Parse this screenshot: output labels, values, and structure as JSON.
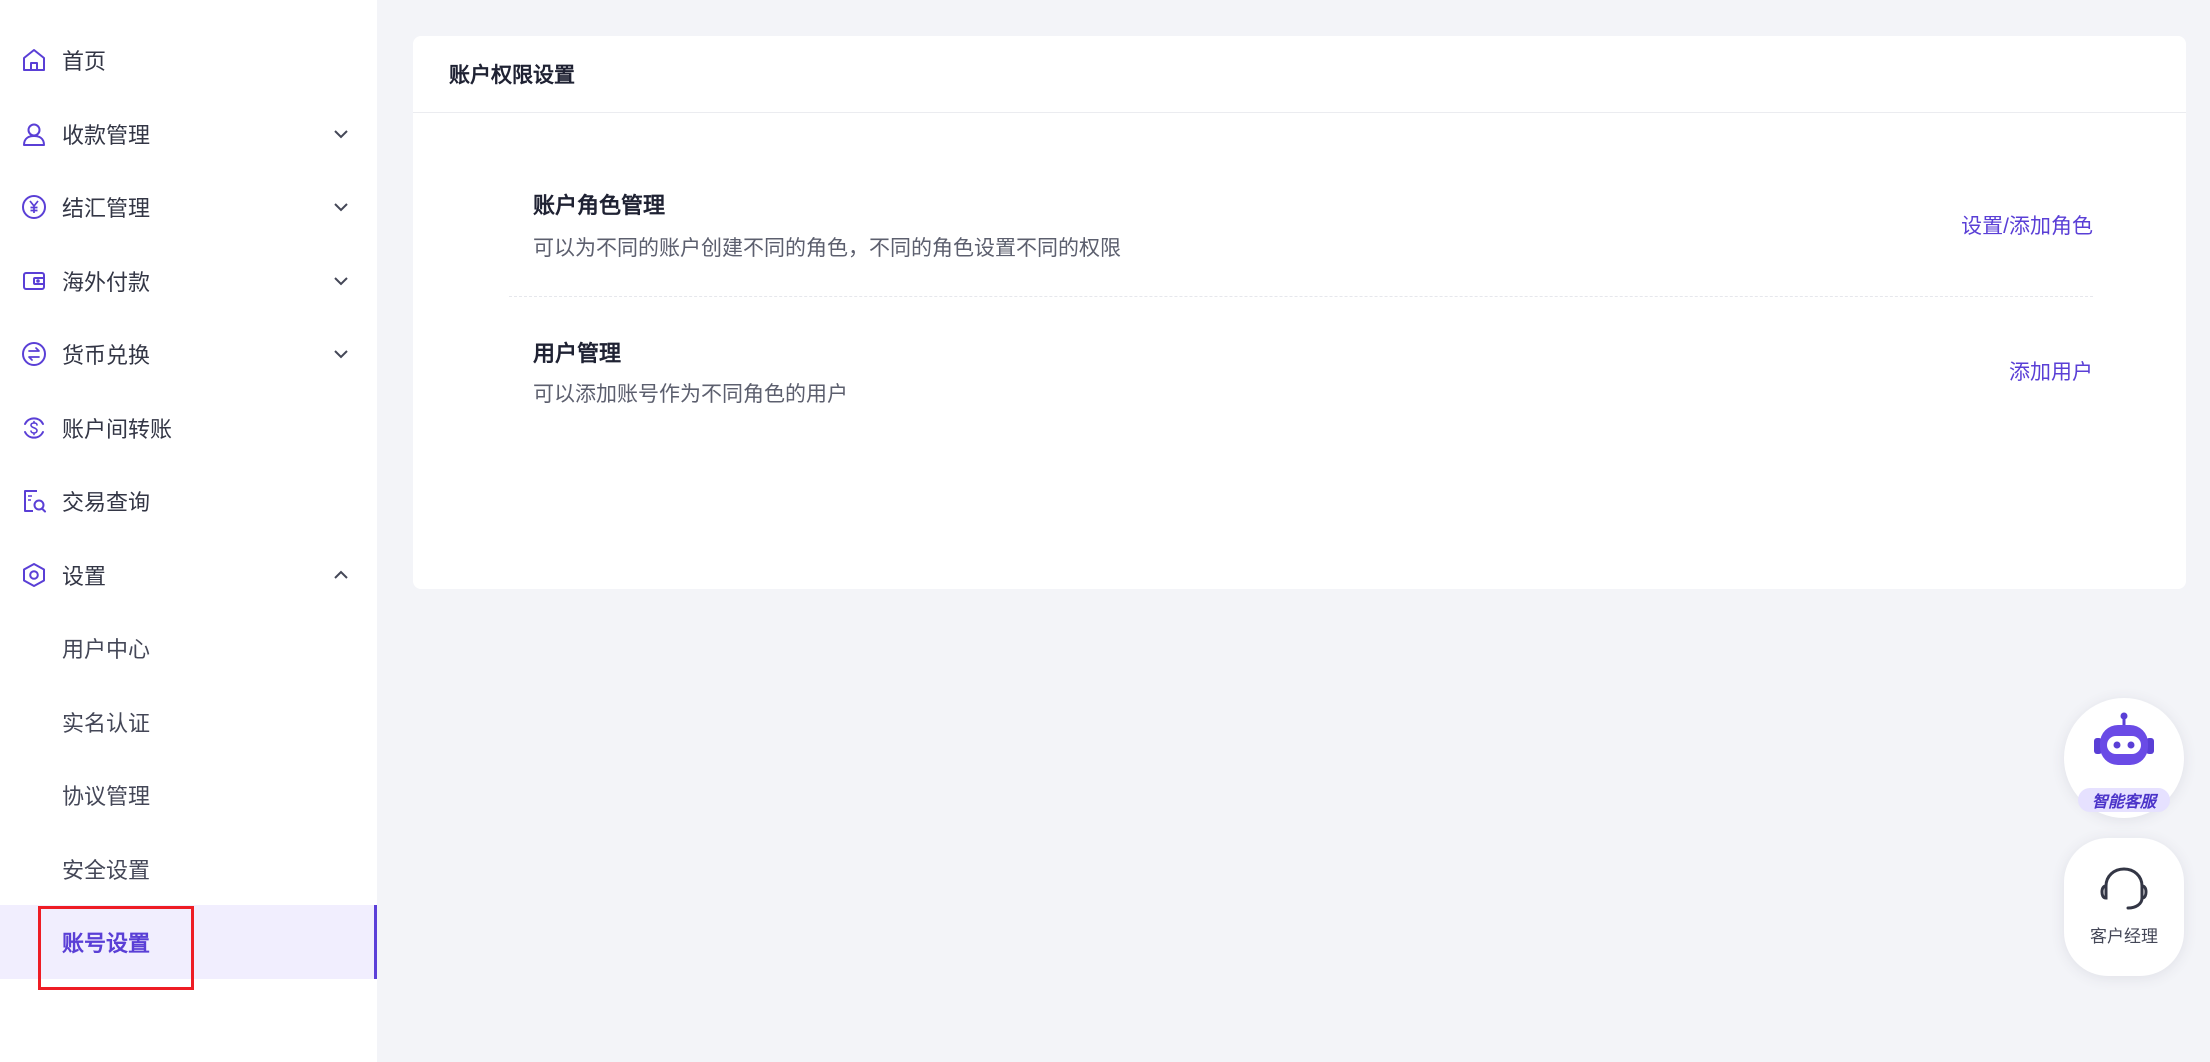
{
  "sidebar": {
    "items": [
      {
        "label": "首页",
        "icon": "home-icon"
      },
      {
        "label": "收款管理",
        "icon": "user-icon",
        "expand": "collapsed"
      },
      {
        "label": "结汇管理",
        "icon": "yen-icon",
        "expand": "collapsed"
      },
      {
        "label": "海外付款",
        "icon": "wallet-icon",
        "expand": "collapsed"
      },
      {
        "label": "货币兑换",
        "icon": "exchange-icon",
        "expand": "collapsed"
      },
      {
        "label": "账户间转账",
        "icon": "dollar-transfer-icon"
      },
      {
        "label": "交易查询",
        "icon": "transaction-search-icon"
      },
      {
        "label": "设置",
        "icon": "settings-icon",
        "expand": "expanded"
      }
    ],
    "settings_sub_items": [
      {
        "label": "用户中心"
      },
      {
        "label": "实名认证"
      },
      {
        "label": "协议管理"
      },
      {
        "label": "安全设置"
      },
      {
        "label": "账号设置",
        "active": true
      }
    ]
  },
  "main": {
    "card_title": "账户权限设置",
    "rows": [
      {
        "title": "账户角色管理",
        "description": "可以为不同的账户创建不同的角色，不同的角色设置不同的权限",
        "action": "设置/添加角色"
      },
      {
        "title": "用户管理",
        "description": "可以添加账号作为不同角色的用户",
        "action": "添加用户"
      }
    ]
  },
  "floating": {
    "assistant_label": "智能客服",
    "manager_label": "客户经理"
  },
  "colors": {
    "accent": "#5a3fd6",
    "active_bg": "#f1eefe",
    "highlight_border": "#ee1c24",
    "page_bg": "#f3f4f8"
  }
}
